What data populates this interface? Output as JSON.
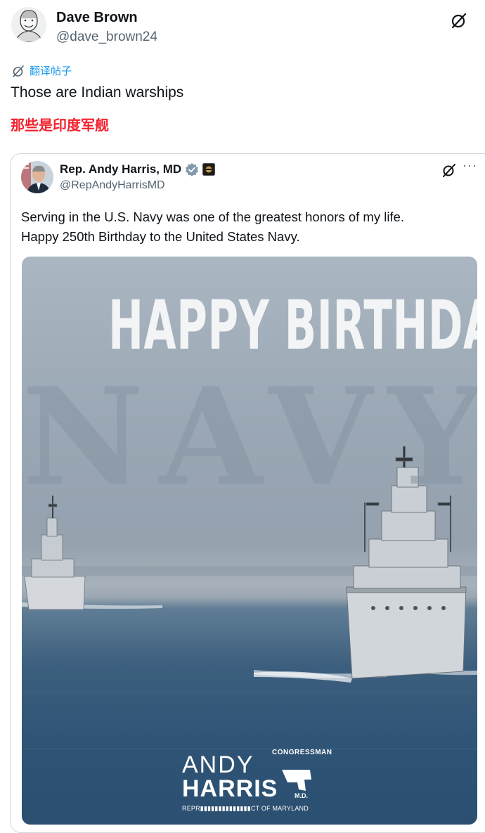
{
  "author": {
    "name": "Dave Brown",
    "handle": "@dave_brown24"
  },
  "translate_label": "翻译帖子",
  "post": {
    "text": "Those are Indian warships",
    "translation": "那些是印度军舰"
  },
  "quoted_post": {
    "name": "Rep. Andy Harris, MD",
    "handle": "@RepAndyHarrisMD",
    "more_label": "···",
    "text_lines": [
      "Serving in the U.S. Navy was one of the greatest honors of my life.",
      "Happy 250th Birthday to the United States Navy."
    ],
    "image": {
      "headline": "HAPPY BIRTHDAY",
      "subheadline": "NAVY",
      "logo": {
        "top_label": "CONGRESSMAN",
        "first_name": "ANDY",
        "last_name": "HARRIS",
        "suffix": "M.D.",
        "district_line": "REPR▮▮▮▮▮▮▮▮▮▮▮▮▮▮CT OF MARYLAND"
      }
    }
  },
  "icons": {
    "grok": "grok-icon",
    "translate": "translate-icon",
    "verified": "verified-badge-icon",
    "affiliate": "affiliate-badge-icon",
    "more": "more-dots-icon"
  },
  "colors": {
    "link_blue": "#1d9bf0",
    "translation_red": "#f4212e",
    "secondary_text": "#536471",
    "verified_badge": "#829aab"
  }
}
